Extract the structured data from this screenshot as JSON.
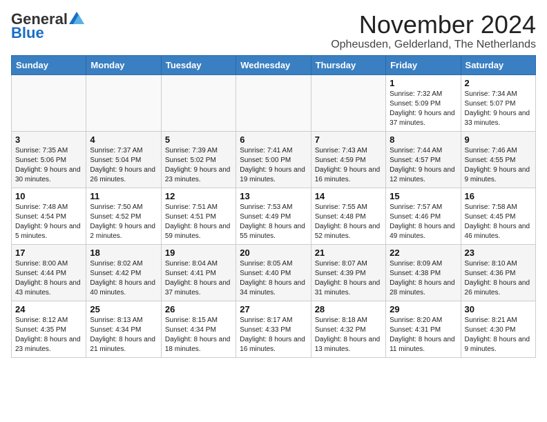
{
  "logo": {
    "general": "General",
    "blue": "Blue"
  },
  "title": "November 2024",
  "location": "Opheusden, Gelderland, The Netherlands",
  "weekdays": [
    "Sunday",
    "Monday",
    "Tuesday",
    "Wednesday",
    "Thursday",
    "Friday",
    "Saturday"
  ],
  "weeks": [
    [
      {
        "day": "",
        "info": ""
      },
      {
        "day": "",
        "info": ""
      },
      {
        "day": "",
        "info": ""
      },
      {
        "day": "",
        "info": ""
      },
      {
        "day": "",
        "info": ""
      },
      {
        "day": "1",
        "info": "Sunrise: 7:32 AM\nSunset: 5:09 PM\nDaylight: 9 hours and 37 minutes."
      },
      {
        "day": "2",
        "info": "Sunrise: 7:34 AM\nSunset: 5:07 PM\nDaylight: 9 hours and 33 minutes."
      }
    ],
    [
      {
        "day": "3",
        "info": "Sunrise: 7:35 AM\nSunset: 5:06 PM\nDaylight: 9 hours and 30 minutes."
      },
      {
        "day": "4",
        "info": "Sunrise: 7:37 AM\nSunset: 5:04 PM\nDaylight: 9 hours and 26 minutes."
      },
      {
        "day": "5",
        "info": "Sunrise: 7:39 AM\nSunset: 5:02 PM\nDaylight: 9 hours and 23 minutes."
      },
      {
        "day": "6",
        "info": "Sunrise: 7:41 AM\nSunset: 5:00 PM\nDaylight: 9 hours and 19 minutes."
      },
      {
        "day": "7",
        "info": "Sunrise: 7:43 AM\nSunset: 4:59 PM\nDaylight: 9 hours and 16 minutes."
      },
      {
        "day": "8",
        "info": "Sunrise: 7:44 AM\nSunset: 4:57 PM\nDaylight: 9 hours and 12 minutes."
      },
      {
        "day": "9",
        "info": "Sunrise: 7:46 AM\nSunset: 4:55 PM\nDaylight: 9 hours and 9 minutes."
      }
    ],
    [
      {
        "day": "10",
        "info": "Sunrise: 7:48 AM\nSunset: 4:54 PM\nDaylight: 9 hours and 5 minutes."
      },
      {
        "day": "11",
        "info": "Sunrise: 7:50 AM\nSunset: 4:52 PM\nDaylight: 9 hours and 2 minutes."
      },
      {
        "day": "12",
        "info": "Sunrise: 7:51 AM\nSunset: 4:51 PM\nDaylight: 8 hours and 59 minutes."
      },
      {
        "day": "13",
        "info": "Sunrise: 7:53 AM\nSunset: 4:49 PM\nDaylight: 8 hours and 55 minutes."
      },
      {
        "day": "14",
        "info": "Sunrise: 7:55 AM\nSunset: 4:48 PM\nDaylight: 8 hours and 52 minutes."
      },
      {
        "day": "15",
        "info": "Sunrise: 7:57 AM\nSunset: 4:46 PM\nDaylight: 8 hours and 49 minutes."
      },
      {
        "day": "16",
        "info": "Sunrise: 7:58 AM\nSunset: 4:45 PM\nDaylight: 8 hours and 46 minutes."
      }
    ],
    [
      {
        "day": "17",
        "info": "Sunrise: 8:00 AM\nSunset: 4:44 PM\nDaylight: 8 hours and 43 minutes."
      },
      {
        "day": "18",
        "info": "Sunrise: 8:02 AM\nSunset: 4:42 PM\nDaylight: 8 hours and 40 minutes."
      },
      {
        "day": "19",
        "info": "Sunrise: 8:04 AM\nSunset: 4:41 PM\nDaylight: 8 hours and 37 minutes."
      },
      {
        "day": "20",
        "info": "Sunrise: 8:05 AM\nSunset: 4:40 PM\nDaylight: 8 hours and 34 minutes."
      },
      {
        "day": "21",
        "info": "Sunrise: 8:07 AM\nSunset: 4:39 PM\nDaylight: 8 hours and 31 minutes."
      },
      {
        "day": "22",
        "info": "Sunrise: 8:09 AM\nSunset: 4:38 PM\nDaylight: 8 hours and 28 minutes."
      },
      {
        "day": "23",
        "info": "Sunrise: 8:10 AM\nSunset: 4:36 PM\nDaylight: 8 hours and 26 minutes."
      }
    ],
    [
      {
        "day": "24",
        "info": "Sunrise: 8:12 AM\nSunset: 4:35 PM\nDaylight: 8 hours and 23 minutes."
      },
      {
        "day": "25",
        "info": "Sunrise: 8:13 AM\nSunset: 4:34 PM\nDaylight: 8 hours and 21 minutes."
      },
      {
        "day": "26",
        "info": "Sunrise: 8:15 AM\nSunset: 4:34 PM\nDaylight: 8 hours and 18 minutes."
      },
      {
        "day": "27",
        "info": "Sunrise: 8:17 AM\nSunset: 4:33 PM\nDaylight: 8 hours and 16 minutes."
      },
      {
        "day": "28",
        "info": "Sunrise: 8:18 AM\nSunset: 4:32 PM\nDaylight: 8 hours and 13 minutes."
      },
      {
        "day": "29",
        "info": "Sunrise: 8:20 AM\nSunset: 4:31 PM\nDaylight: 8 hours and 11 minutes."
      },
      {
        "day": "30",
        "info": "Sunrise: 8:21 AM\nSunset: 4:30 PM\nDaylight: 8 hours and 9 minutes."
      }
    ]
  ]
}
